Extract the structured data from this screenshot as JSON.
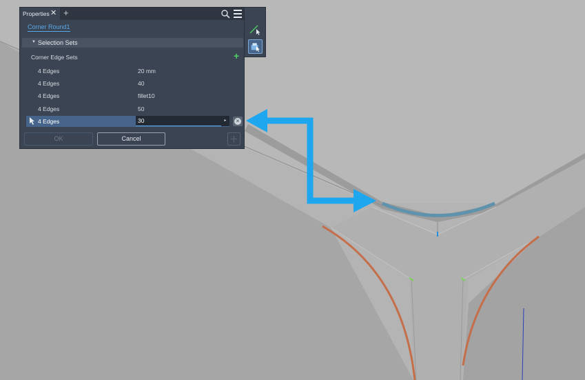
{
  "panel": {
    "tab_label": "Properties",
    "close_glyph": "✕",
    "add_tab_glyph": "+",
    "search_icon": "search-icon",
    "menu_icon": "hamburger-menu-icon",
    "feature_name": "Corner Round1",
    "section_arrow": "▼",
    "section_label": "Selection Sets",
    "subsection_label": "Corner Edge Sets",
    "add_set_glyph": "+",
    "rows": [
      {
        "label": "4 Edges",
        "value": "20 mm"
      },
      {
        "label": "4 Edges",
        "value": "40"
      },
      {
        "label": "4 Edges",
        "value": "fillet10"
      },
      {
        "label": "4 Edges",
        "value": "50"
      },
      {
        "label": "4 Edges",
        "value": "30"
      }
    ],
    "input_arrow_glyph": "▸",
    "clear_glyph": "×",
    "ok_label": "OK",
    "cancel_label": "Cancel"
  },
  "toolbar": {
    "items": [
      "select-edge-icon",
      "select-feature-icon"
    ]
  },
  "colors": {
    "panel_bg": "#3b4453",
    "accent_blue": "#58a9e8",
    "callout_arrow": "#1ea7ee",
    "fillet_orange": "#c46e4a",
    "selected_fillet": "#5f93ad",
    "add_green": "#4fcf5d"
  }
}
